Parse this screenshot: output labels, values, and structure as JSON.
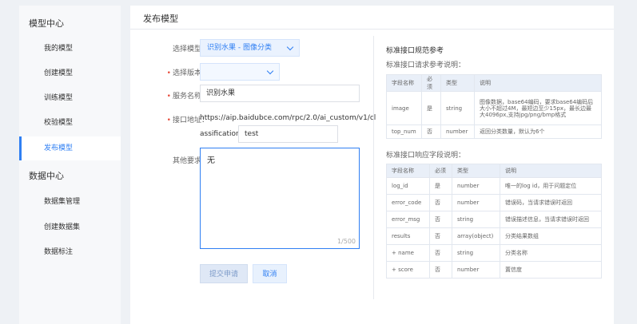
{
  "sidebar": {
    "model_center": "模型中心",
    "model_items": [
      {
        "label": "我的模型"
      },
      {
        "label": "创建模型"
      },
      {
        "label": "训练模型"
      },
      {
        "label": "校验模型"
      },
      {
        "label": "发布模型"
      }
    ],
    "data_center": "数据中心",
    "data_items": [
      {
        "label": "数据集管理"
      },
      {
        "label": "创建数据集"
      },
      {
        "label": "数据标注"
      }
    ]
  },
  "main": {
    "title": "发布模型",
    "form": {
      "model_label": "选择模型：",
      "model_value": "识别水果 - 图像分类",
      "version_label": "选择版本：",
      "version_value": "",
      "service_label": "服务名称：",
      "service_value": "识别水果",
      "api_label": "接口地址：",
      "api_url_line1": "https://aip.baidubce.com/rpc/2.0/ai_custom/v1/cl",
      "api_url_line2": "assification/",
      "api_suffix_value": "test",
      "other_label": "其他要求：",
      "other_value": "无",
      "counter": "1/500",
      "submit_label": "提交申请",
      "cancel_label": "取消"
    },
    "reference": {
      "title": "标准接口规范参考",
      "request_title": "标准接口请求参考说明：",
      "request_headers": [
        "字段名称",
        "必须",
        "类型",
        "说明"
      ],
      "request_rows": [
        [
          "image",
          "是",
          "string",
          "图像数据，base64编码，要求base64编码后大小不超过4M，最短边至少15px，最长边最大4096px,支持jpg/png/bmp格式"
        ],
        [
          "top_num",
          "否",
          "number",
          "返回分类数量，默认为6个"
        ]
      ],
      "response_title": "标准接口响应字段说明：",
      "response_headers": [
        "字段名称",
        "必须",
        "类型",
        "说明"
      ],
      "response_rows": [
        [
          "log_id",
          "是",
          "number",
          "唯一的log id，用于问题定位"
        ],
        [
          "error_code",
          "否",
          "number",
          "错误码，当请求错误时返回"
        ],
        [
          "error_msg",
          "否",
          "string",
          "错误描述信息，当请求错误时返回"
        ],
        [
          "results",
          "否",
          "array(object)",
          "分类结果数组"
        ],
        [
          "+ name",
          "否",
          "string",
          "分类名称"
        ],
        [
          "+ score",
          "否",
          "number",
          "置信度"
        ]
      ]
    }
  }
}
